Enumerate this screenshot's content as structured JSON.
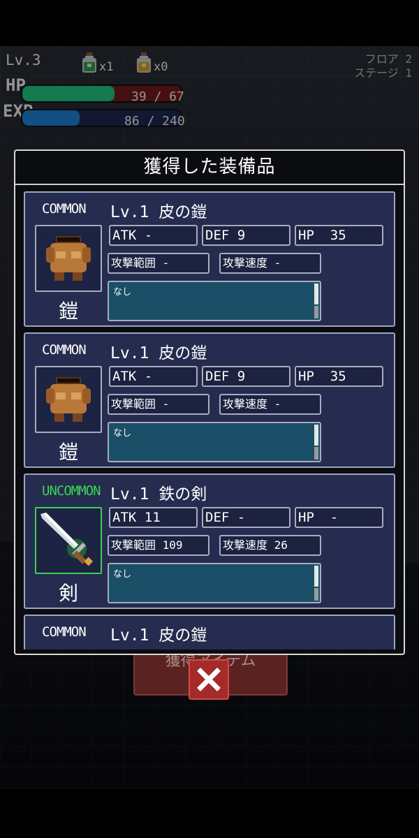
{
  "hud": {
    "level": "Lv.3",
    "potion_green_count": "x1",
    "potion_yellow_count": "x0",
    "floor": "フロア 2",
    "stage": "ステージ 1",
    "hp_label": "HP",
    "hp_text": "39 / 67",
    "hp_fraction": 0.58,
    "exp_label": "EXP",
    "exp_text": "86 / 240",
    "exp_fraction": 0.36
  },
  "background_button": "獲得アイテム",
  "panel": {
    "title": "獲得した装備品",
    "items": [
      {
        "rarity": "COMMON",
        "name": "Lv.1 皮の鎧",
        "type": "鎧",
        "icon": "leather-armor-icon",
        "atk": "ATK -",
        "def": "DEF 9",
        "hp": "HP  35",
        "range": "攻撃範囲 -",
        "speed": "攻撃速度 -",
        "desc": "なし"
      },
      {
        "rarity": "COMMON",
        "name": "Lv.1 皮の鎧",
        "type": "鎧",
        "icon": "leather-armor-icon",
        "atk": "ATK -",
        "def": "DEF 9",
        "hp": "HP  35",
        "range": "攻撃範囲 -",
        "speed": "攻撃速度 -",
        "desc": "なし"
      },
      {
        "rarity": "UNCOMMON",
        "name": "Lv.1 鉄の剣",
        "type": "剣",
        "icon": "iron-sword-icon",
        "atk": "ATK 11",
        "def": "DEF -",
        "hp": "HP  -",
        "range": "攻撃範囲 109",
        "speed": "攻撃速度 26",
        "desc": "なし"
      },
      {
        "rarity": "COMMON",
        "name": "Lv.1 皮の鎧"
      }
    ]
  },
  "colors": {
    "hp_fill": "#21d089",
    "hp_back": "#7a1c1c",
    "exp_fill": "#1e88e5",
    "exp_back": "#1f2a55",
    "common": "#ffffff",
    "uncommon": "#39d353"
  }
}
